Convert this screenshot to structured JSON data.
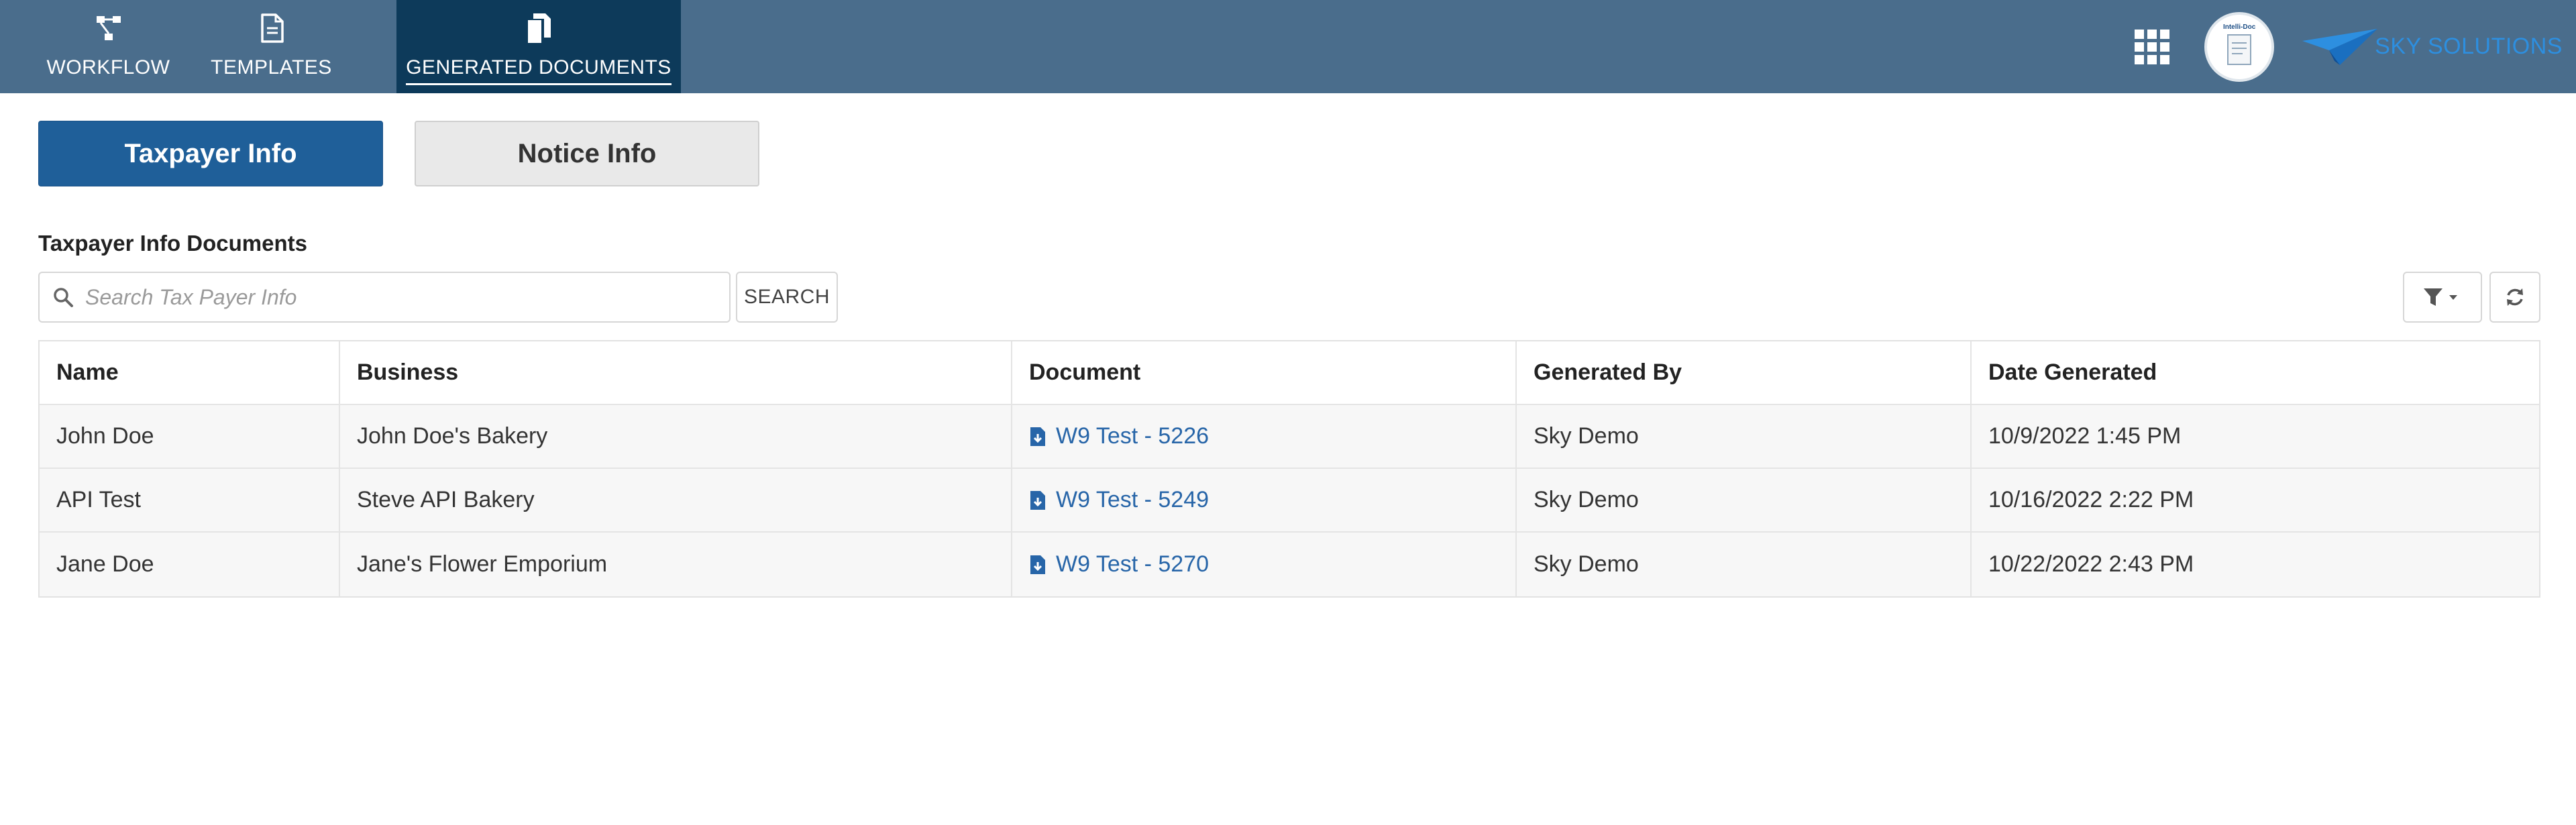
{
  "nav": {
    "items": [
      {
        "label": "WORKFLOW",
        "icon": "workflow-icon"
      },
      {
        "label": "TEMPLATES",
        "icon": "document-icon"
      },
      {
        "label": "GENERATED DOCUMENTS",
        "icon": "copy-documents-icon"
      }
    ],
    "active": "GENERATED DOCUMENTS"
  },
  "header": {
    "avatar_label": "Intelli-Doc",
    "brand": "SKY SOLUTIONS",
    "apps_icon": "grid-apps-icon"
  },
  "tabs": [
    {
      "label": "Taxpayer Info",
      "active": true
    },
    {
      "label": "Notice Info",
      "active": false
    }
  ],
  "section_title": "Taxpayer Info Documents",
  "search": {
    "placeholder": "Search Tax Payer Info",
    "value": "",
    "button_label": "SEARCH"
  },
  "table": {
    "columns": [
      "Name",
      "Business",
      "Document",
      "Generated By",
      "Date Generated"
    ],
    "rows": [
      {
        "name": "John Doe",
        "business": "John Doe's Bakery",
        "document": "W9 Test - 5226",
        "generated_by": "Sky Demo",
        "date": "10/9/2022 1:45 PM"
      },
      {
        "name": "API Test",
        "business": "Steve API Bakery",
        "document": "W9 Test - 5249",
        "generated_by": "Sky Demo",
        "date": "10/16/2022 2:22 PM"
      },
      {
        "name": "Jane Doe",
        "business": "Jane's Flower Emporium",
        "document": "W9 Test - 5270",
        "generated_by": "Sky Demo",
        "date": "10/22/2022 2:43 PM"
      }
    ]
  },
  "colors": {
    "topbar": "#4a6d8c",
    "nav_active": "#0d3a5a",
    "primary_button": "#1f5f99",
    "link": "#2765a8",
    "brand": "#2d8fe0"
  }
}
